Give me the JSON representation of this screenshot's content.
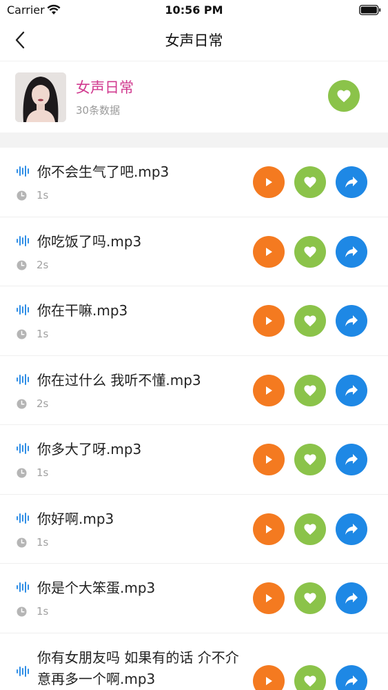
{
  "status_bar": {
    "carrier": "Carrier",
    "time": "10:56 PM"
  },
  "nav": {
    "title": "女声日常",
    "back_icon": "chevron-left-icon"
  },
  "album": {
    "title": "女声日常",
    "count": "30条数据",
    "like_icon": "heart-icon",
    "title_color": "#d13a8f"
  },
  "colors": {
    "play": "#f47a20",
    "like": "#8bc34a",
    "share": "#1e88e5",
    "wave": "#2f8ee6"
  },
  "items": [
    {
      "title": "你不会生气了吧.mp3",
      "duration": "1s"
    },
    {
      "title": "你吃饭了吗.mp3",
      "duration": "2s"
    },
    {
      "title": "你在干嘛.mp3",
      "duration": "1s"
    },
    {
      "title": "你在过什么 我听不懂.mp3",
      "duration": "2s"
    },
    {
      "title": "你多大了呀.mp3",
      "duration": "1s"
    },
    {
      "title": "你好啊.mp3",
      "duration": "1s"
    },
    {
      "title": "你是个大笨蛋.mp3",
      "duration": "1s"
    },
    {
      "title": "你有女朋友吗 如果有的话 介不介意再多一个啊.mp3",
      "duration": ""
    }
  ]
}
